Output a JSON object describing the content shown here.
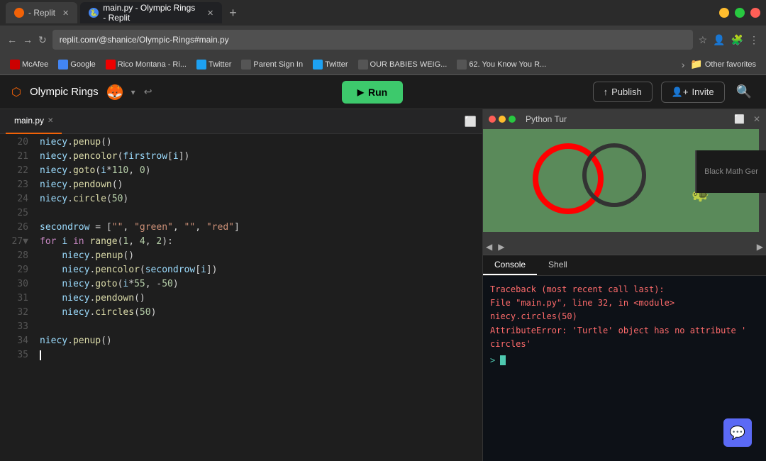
{
  "browser": {
    "tabs": [
      {
        "id": "tab1",
        "label": "- Replit",
        "favicon": "replit",
        "active": false
      },
      {
        "id": "tab2",
        "label": "main.py - Olympic Rings - Replit",
        "favicon": "main",
        "active": true
      }
    ],
    "new_tab_label": "+",
    "address": "replit.com/@shanice/Olympic-Rings#main.py",
    "window_controls": {
      "minimize": "—",
      "maximize": "⬜",
      "close": "✕"
    }
  },
  "bookmarks": [
    {
      "id": "bk1",
      "label": "McAfee",
      "icon_color": "#c00"
    },
    {
      "id": "bk2",
      "label": "Google",
      "icon_color": "#4285f4"
    },
    {
      "id": "bk3",
      "label": "Rico Montana - Ri...",
      "icon_color": "#e00"
    },
    {
      "id": "bk4",
      "label": "Twitter",
      "icon_color": "#1da1f2"
    },
    {
      "id": "bk5",
      "label": "Parent Sign In",
      "icon_color": "#555"
    },
    {
      "id": "bk6",
      "label": "Twitter",
      "icon_color": "#1da1f2"
    },
    {
      "id": "bk7",
      "label": "OUR BABIES WEIG...",
      "icon_color": "#555"
    },
    {
      "id": "bk8",
      "label": "62. You Know You R...",
      "icon_color": "#555"
    },
    {
      "id": "bk_more",
      "label": "Other favorites",
      "icon_color": "#e8a000"
    }
  ],
  "replit": {
    "project_name": "Olympic Rings",
    "run_label": "Run",
    "publish_label": "Publish",
    "invite_label": "Invite",
    "editor_tab": "main.py",
    "turtle_title": "Python Tur"
  },
  "code_lines": [
    {
      "num": "20",
      "content": "niecy.penup()"
    },
    {
      "num": "21",
      "content": "niecy.pencolor(firstrow[i])"
    },
    {
      "num": "22",
      "content": "niecy.goto(i*110, 0)"
    },
    {
      "num": "23",
      "content": "niecy.pendown()"
    },
    {
      "num": "24",
      "content": "niecy.circle(50)"
    },
    {
      "num": "25",
      "content": ""
    },
    {
      "num": "26",
      "content": "secondrow = [\"\", \"green\", \"\", \"red\"]"
    },
    {
      "num": "27",
      "content": "for i in range(1, 4, 2):",
      "arrow": true
    },
    {
      "num": "28",
      "content": "    niecy.penup()"
    },
    {
      "num": "29",
      "content": "    niecy.pencolor(secondrow[i])"
    },
    {
      "num": "30",
      "content": "    niecy.goto(i*55, -50)"
    },
    {
      "num": "31",
      "content": "    niecy.pendown()"
    },
    {
      "num": "32",
      "content": "    niecy.circles(50)"
    },
    {
      "num": "33",
      "content": ""
    },
    {
      "num": "34",
      "content": "niecy.penup()"
    },
    {
      "num": "35",
      "content": ""
    }
  ],
  "console": {
    "tabs": [
      "Console",
      "Shell"
    ],
    "active_tab": "Console",
    "error_lines": [
      "Traceback (most recent call last):",
      "  File \"main.py\", line 32, in <module>",
      "    niecy.circles(50)",
      "AttributeError: 'Turtle' object has no attribute '",
      "circles'"
    ],
    "prompt": "> "
  },
  "side_panel": {
    "label": "Black Math Ger"
  }
}
